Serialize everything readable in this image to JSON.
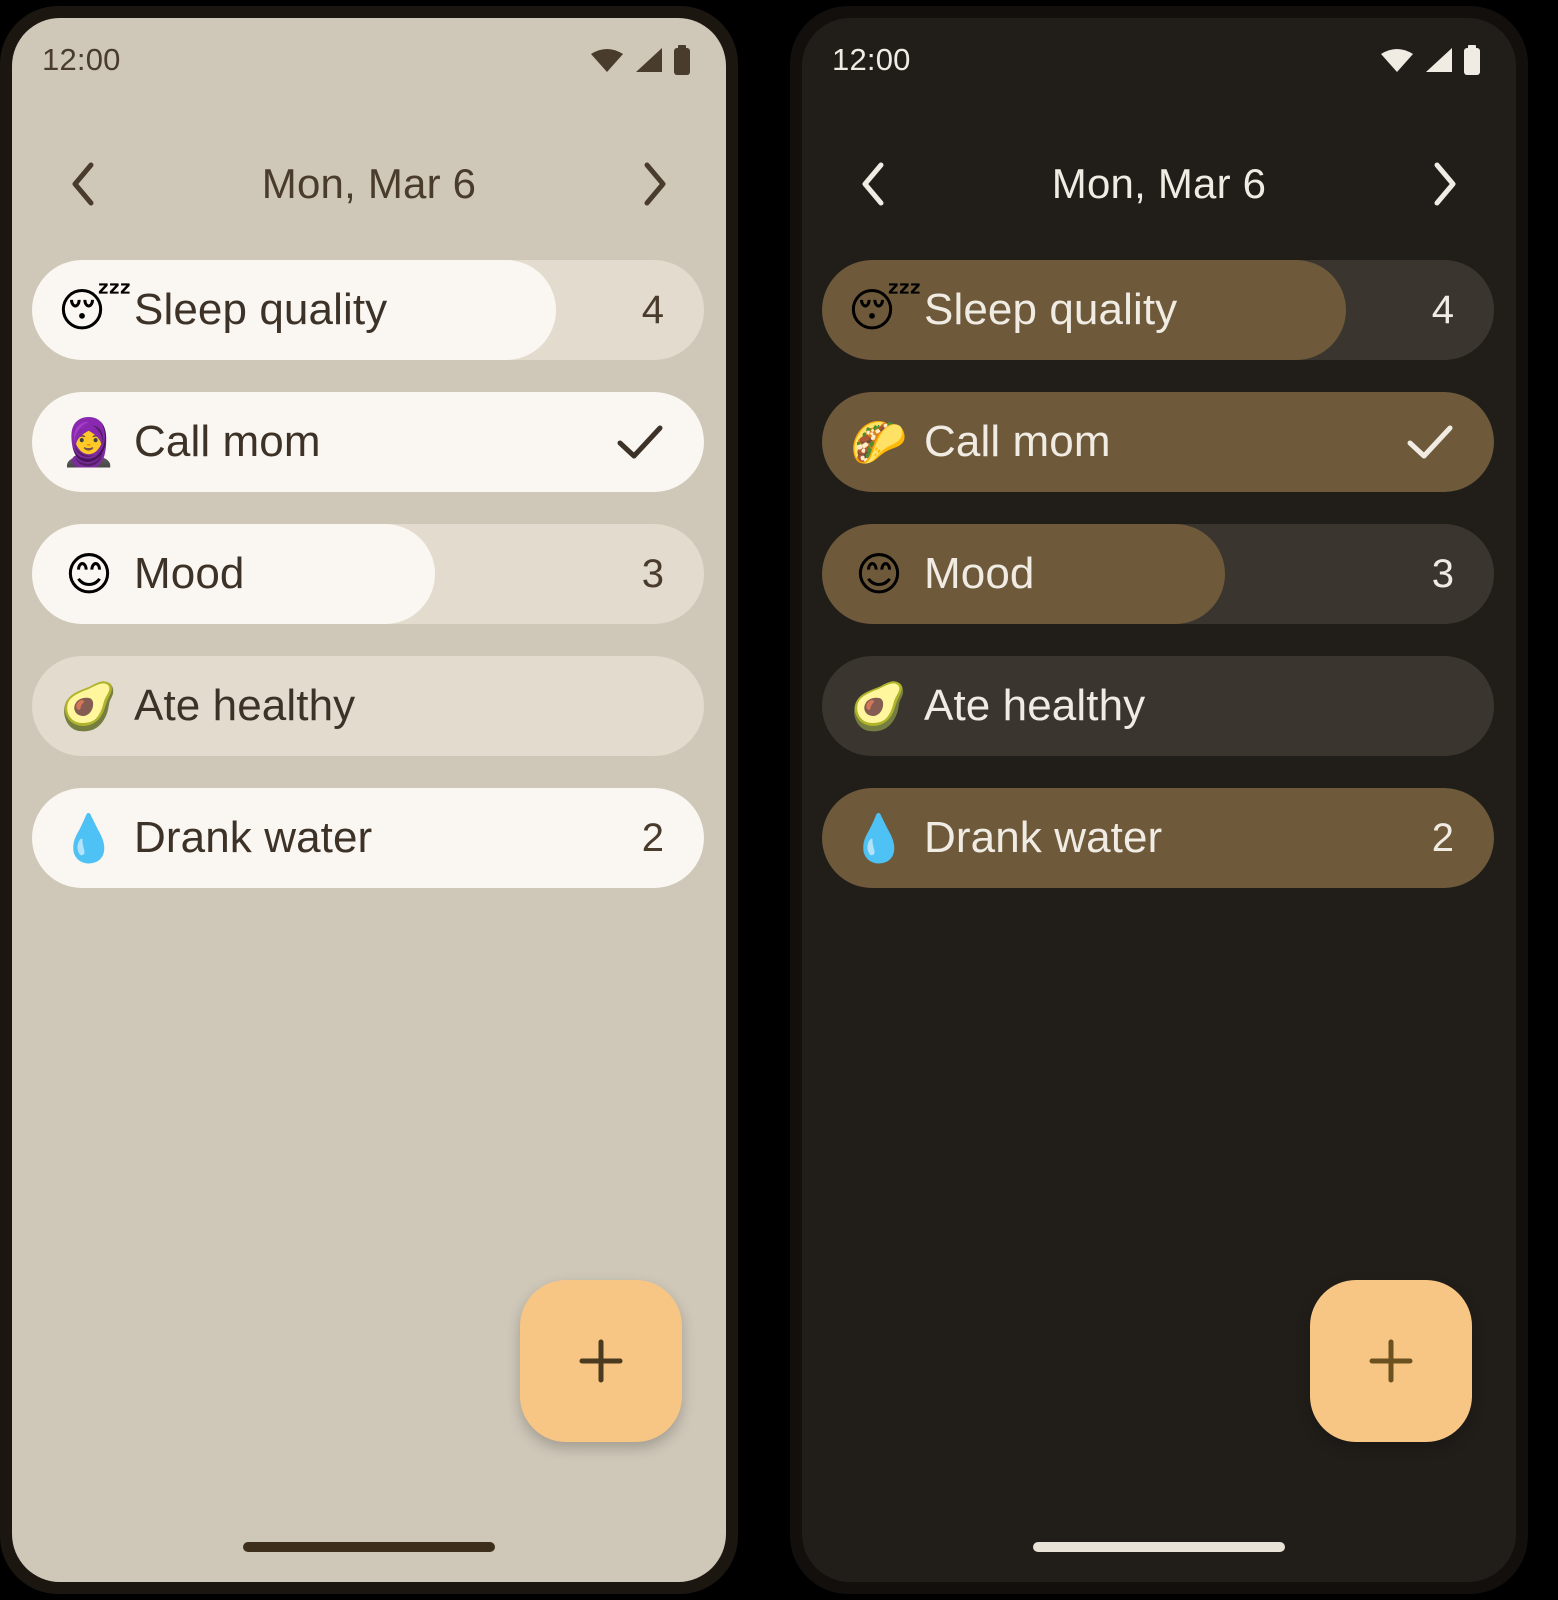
{
  "theme_colors": {
    "light_bg": "#cfc8b9",
    "light_track": "#e3dbcd",
    "light_fill": "#faf6f1",
    "light_text": "#3d3227",
    "dark_bg": "#211e1a",
    "dark_track": "#3a352f",
    "dark_fill": "#6e5a3a",
    "dark_text": "#f0ebe3",
    "accent_fab": "#f8c684",
    "frame": "#1c1611"
  },
  "panels": [
    {
      "variant": "light",
      "status_bar": {
        "clock": "12:00",
        "icons": [
          "wifi-icon",
          "cellular-signal-icon",
          "battery-icon"
        ]
      },
      "date_nav": {
        "prev_label": "chevron-left-icon",
        "title": "Mon, Mar 6",
        "next_label": "chevron-right-icon"
      },
      "habits": [
        {
          "emoji": "😴",
          "emoji_name": "sleeping-face-emoji",
          "label": "Sleep quality",
          "value": "4",
          "progress": 78,
          "checked": false
        },
        {
          "emoji": "🧕",
          "emoji_name": "woman-with-headscarf-emoji",
          "label": "Call mom",
          "value": "",
          "progress": 100,
          "checked": true
        },
        {
          "emoji": "😊",
          "emoji_name": "smiling-face-emoji",
          "label": "Mood",
          "value": "3",
          "progress": 60,
          "checked": false
        },
        {
          "emoji": "🥑",
          "emoji_name": "avocado-emoji",
          "label": "Ate healthy",
          "value": "",
          "progress": 0,
          "checked": false
        },
        {
          "emoji": "💧",
          "emoji_name": "droplet-emoji",
          "label": "Drank water",
          "value": "2",
          "progress": 100,
          "checked": false
        }
      ],
      "fab": {
        "icon": "plus-icon",
        "label": "+"
      }
    },
    {
      "variant": "dark",
      "status_bar": {
        "clock": "12:00",
        "icons": [
          "wifi-icon",
          "cellular-signal-icon",
          "battery-icon"
        ]
      },
      "date_nav": {
        "prev_label": "chevron-left-icon",
        "title": "Mon, Mar 6",
        "next_label": "chevron-right-icon"
      },
      "habits": [
        {
          "emoji": "😴",
          "emoji_name": "sleeping-face-emoji",
          "label": "Sleep quality",
          "value": "4",
          "progress": 78,
          "checked": false
        },
        {
          "emoji": "🌮",
          "emoji_name": "taco-emoji",
          "label": "Call mom",
          "value": "",
          "progress": 100,
          "checked": true
        },
        {
          "emoji": "😊",
          "emoji_name": "smiling-face-emoji",
          "label": "Mood",
          "value": "3",
          "progress": 60,
          "checked": false
        },
        {
          "emoji": "🥑",
          "emoji_name": "avocado-emoji",
          "label": "Ate healthy",
          "value": "",
          "progress": 0,
          "checked": false
        },
        {
          "emoji": "💧",
          "emoji_name": "droplet-emoji",
          "label": "Drank water",
          "value": "2",
          "progress": 100,
          "checked": false
        }
      ],
      "fab": {
        "icon": "plus-icon",
        "label": "+"
      }
    }
  ]
}
